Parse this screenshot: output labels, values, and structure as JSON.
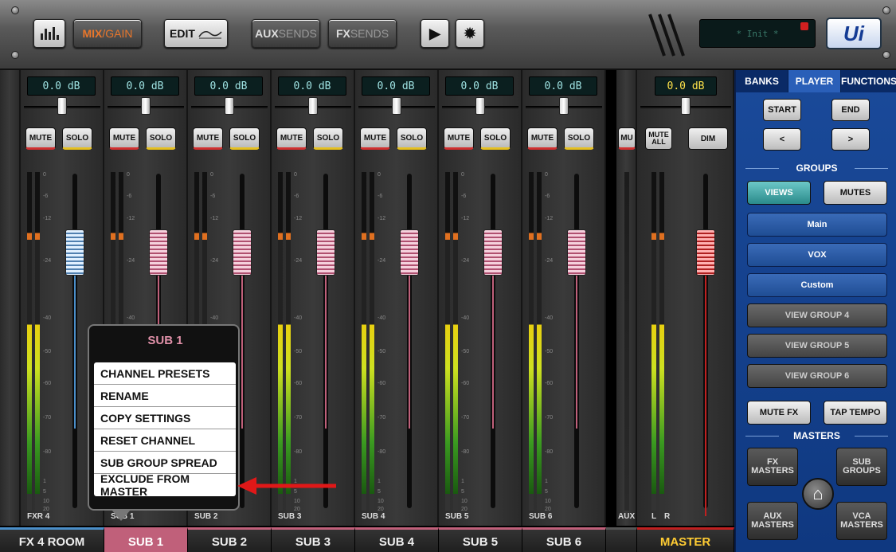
{
  "toolbar": {
    "mix_label_a": "MIX",
    "mix_label_b": "/GAIN",
    "edit_label": "EDIT",
    "aux_label_a": "AUX",
    "aux_label_b": "SENDS",
    "fx_label_a": "FX",
    "fx_label_b": "SENDS",
    "play_icon": "▶",
    "settings_icon": "✹",
    "lcd_text": "* Init *",
    "logo": "Ui"
  },
  "channels": [
    {
      "db": "0.0 dB",
      "mute": "MUTE",
      "solo": "SOLO",
      "short": "FXR 4",
      "name": "FX 4 ROOM"
    },
    {
      "db": "0.0 dB",
      "mute": "MUTE",
      "solo": "SOLO",
      "short": "SUB 1",
      "name": "SUB 1"
    },
    {
      "db": "0.0 dB",
      "mute": "MUTE",
      "solo": "SOLO",
      "short": "SUB 2",
      "name": "SUB 2"
    },
    {
      "db": "0.0 dB",
      "mute": "MUTE",
      "solo": "SOLO",
      "short": "SUB 3",
      "name": "SUB 3"
    },
    {
      "db": "0.0 dB",
      "mute": "MUTE",
      "solo": "SOLO",
      "short": "SUB 4",
      "name": "SUB 4"
    },
    {
      "db": "0.0 dB",
      "mute": "MUTE",
      "solo": "SOLO",
      "short": "SUB 5",
      "name": "SUB 5"
    },
    {
      "db": "0.0 dB",
      "mute": "MUTE",
      "solo": "SOLO",
      "short": "SUB 6",
      "name": "SUB 6"
    }
  ],
  "aux_partial": {
    "mute": "MU",
    "short": "AUX"
  },
  "master": {
    "db": "0.0 dB",
    "mute_all": "MUTE ALL",
    "dim": "DIM",
    "l": "L",
    "r": "R",
    "name": "MASTER"
  },
  "meter_ticks": [
    "0",
    "-6",
    "-12",
    "-24",
    "-40",
    "-50",
    "-60",
    "-70",
    "-80",
    "1",
    "5",
    "10",
    "20"
  ],
  "panel": {
    "tabs": [
      "BANKS",
      "PLAYER",
      "FUNCTIONS"
    ],
    "start": "START",
    "end": "END",
    "prev": "<",
    "next": ">",
    "groups_heading": "GROUPS",
    "views": "VIEWS",
    "mutes": "MUTES",
    "view_groups": [
      "Main",
      "VOX",
      "Custom",
      "VIEW GROUP 4",
      "VIEW GROUP 5",
      "VIEW GROUP 6"
    ],
    "mute_fx": "MUTE FX",
    "tap_tempo": "TAP TEMPO",
    "masters_heading": "MASTERS",
    "fx_masters": "FX MASTERS",
    "sub_groups": "SUB GROUPS",
    "aux_masters": "AUX MASTERS",
    "vca_masters": "VCA MASTERS",
    "home_icon": "⌂"
  },
  "popup": {
    "title": "SUB 1",
    "items": [
      "CHANNEL PRESETS",
      "RENAME",
      "COPY SETTINGS",
      "RESET CHANNEL",
      "SUB GROUP SPREAD",
      "EXCLUDE FROM MASTER"
    ]
  },
  "colors": {
    "accent_pink": "#c0607a",
    "accent_blue": "#4a8ec8",
    "master_red": "#c02020",
    "panel_blue": "#1a4a9a"
  }
}
